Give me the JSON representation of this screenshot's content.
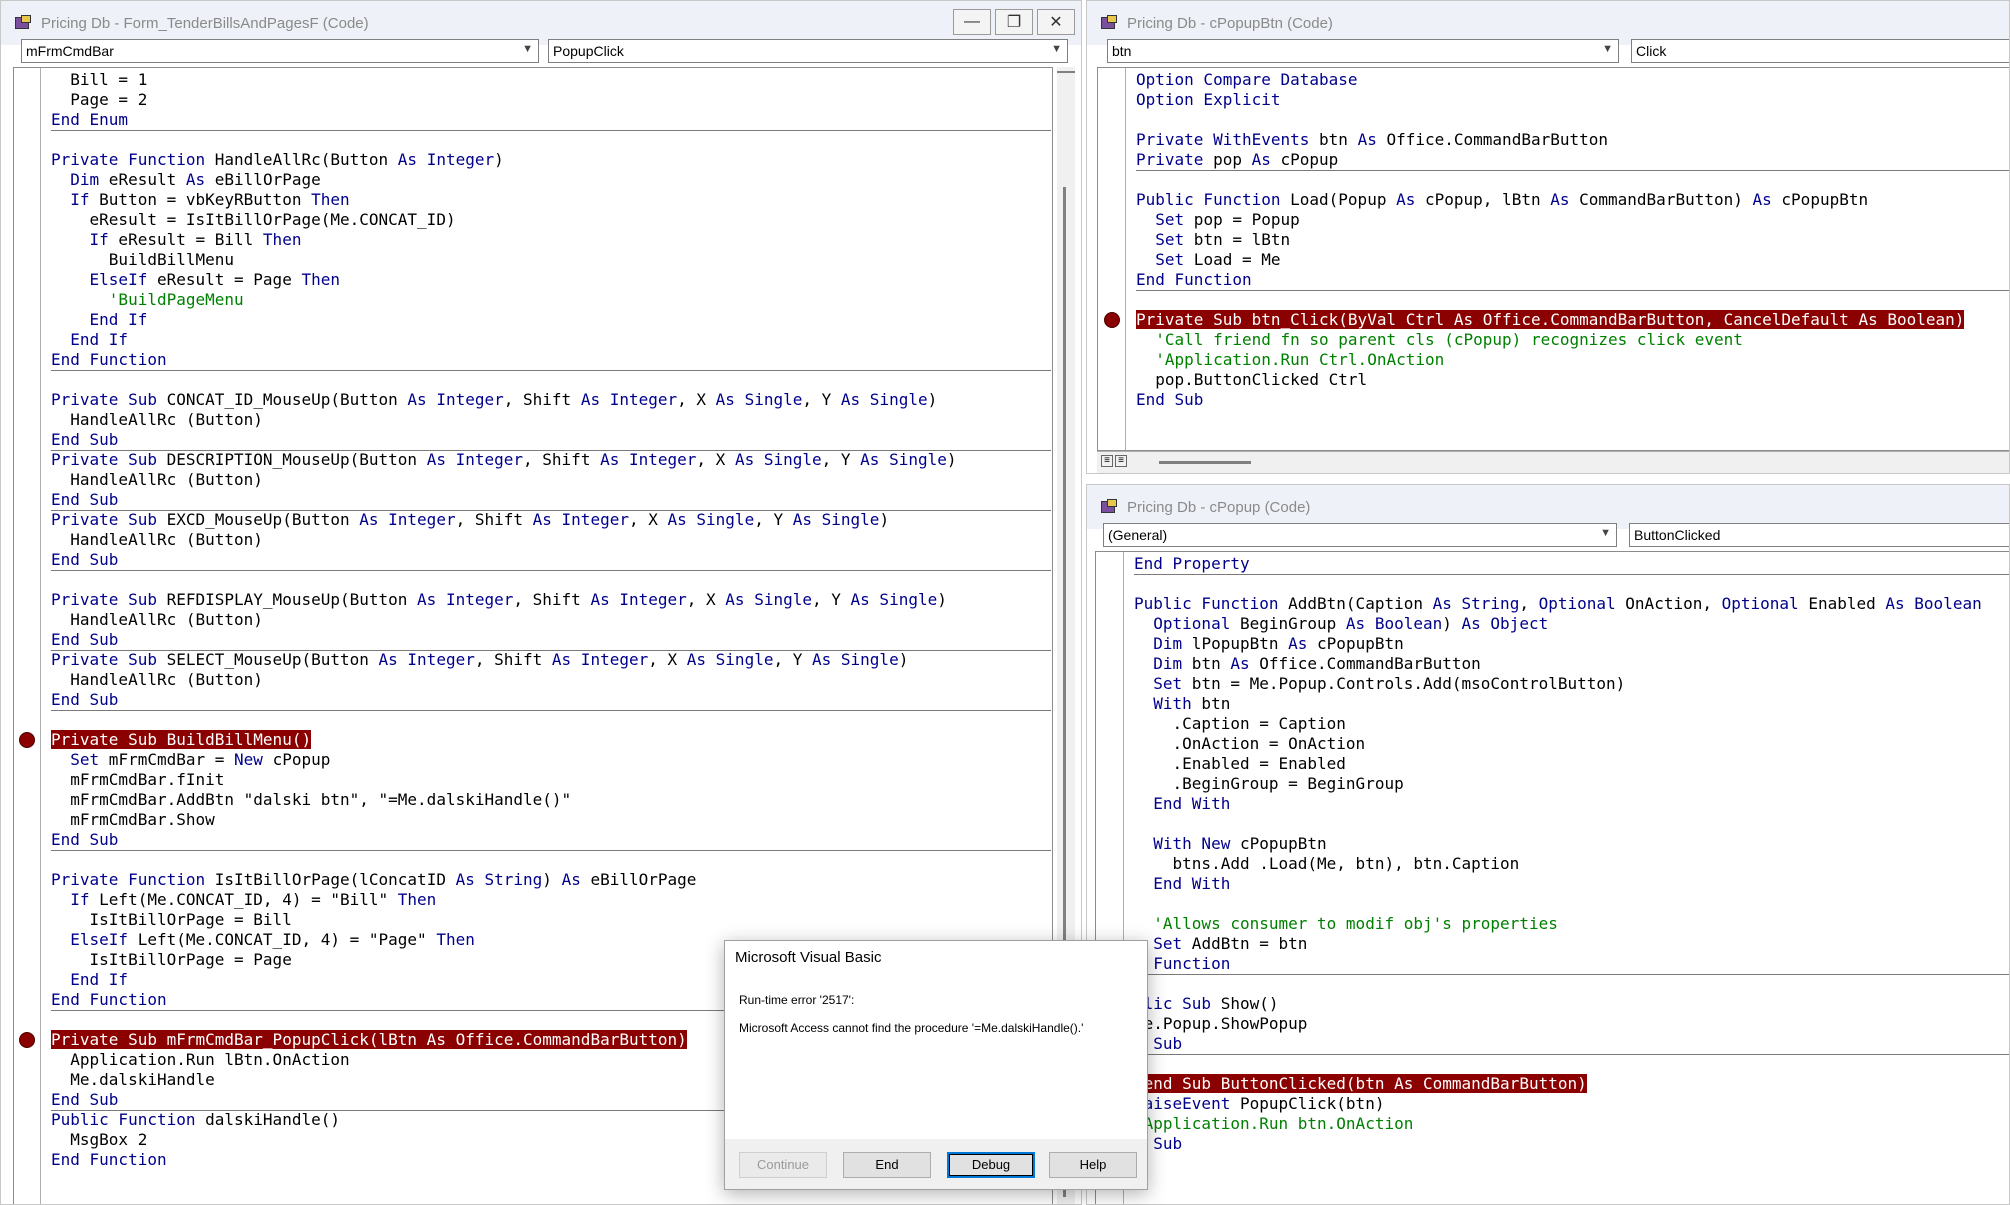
{
  "left_window": {
    "title": "Pricing Db - Form_TenderBillsAndPagesF (Code)",
    "object_combo": "mFrmCmdBar",
    "procedure_combo": "PopupClick",
    "buttons": {
      "minimize": "—",
      "maximize": "❐",
      "close": "✕"
    },
    "code_lines": [
      [
        {
          "t": "  Bill = 1"
        }
      ],
      [
        {
          "t": "  Page = 2"
        }
      ],
      [
        {
          "t": "End Enum",
          "c": "kw"
        }
      ],
      [
        {
          "t": ""
        }
      ],
      [
        {
          "t": "Private Function ",
          "c": "kw"
        },
        {
          "t": "HandleAllRc(Button "
        },
        {
          "t": "As Integer",
          "c": "kw"
        },
        {
          "t": ")"
        }
      ],
      [
        {
          "t": "  "
        },
        {
          "t": "Dim",
          "c": "kw"
        },
        {
          "t": " eResult "
        },
        {
          "t": "As",
          "c": "kw"
        },
        {
          "t": " eBillOrPage"
        }
      ],
      [
        {
          "t": "  "
        },
        {
          "t": "If",
          "c": "kw"
        },
        {
          "t": " Button = vbKeyRButton "
        },
        {
          "t": "Then",
          "c": "kw"
        }
      ],
      [
        {
          "t": "    eResult = IsItBillOrPage(Me.CONCAT_ID)"
        }
      ],
      [
        {
          "t": "    "
        },
        {
          "t": "If",
          "c": "kw"
        },
        {
          "t": " eResult = Bill "
        },
        {
          "t": "Then",
          "c": "kw"
        }
      ],
      [
        {
          "t": "      BuildBillMenu"
        }
      ],
      [
        {
          "t": "    "
        },
        {
          "t": "ElseIf",
          "c": "kw"
        },
        {
          "t": " eResult = Page "
        },
        {
          "t": "Then",
          "c": "kw"
        }
      ],
      [
        {
          "t": "      "
        },
        {
          "t": "'BuildPageMenu",
          "c": "cm"
        }
      ],
      [
        {
          "t": "    "
        },
        {
          "t": "End If",
          "c": "kw"
        }
      ],
      [
        {
          "t": "  "
        },
        {
          "t": "End If",
          "c": "kw"
        }
      ],
      [
        {
          "t": "End Function",
          "c": "kw"
        }
      ],
      [
        {
          "t": ""
        }
      ],
      [
        {
          "t": "Private Sub ",
          "c": "kw"
        },
        {
          "t": "CONCAT_ID_MouseUp(Button "
        },
        {
          "t": "As Integer",
          "c": "kw"
        },
        {
          "t": ", Shift "
        },
        {
          "t": "As Integer",
          "c": "kw"
        },
        {
          "t": ", X "
        },
        {
          "t": "As Single",
          "c": "kw"
        },
        {
          "t": ", Y "
        },
        {
          "t": "As Single",
          "c": "kw"
        },
        {
          "t": ")"
        }
      ],
      [
        {
          "t": "  HandleAllRc (Button)"
        }
      ],
      [
        {
          "t": "End Sub",
          "c": "kw"
        }
      ],
      [
        {
          "t": "Private Sub ",
          "c": "kw"
        },
        {
          "t": "DESCRIPTION_MouseUp(Button "
        },
        {
          "t": "As Integer",
          "c": "kw"
        },
        {
          "t": ", Shift "
        },
        {
          "t": "As Integer",
          "c": "kw"
        },
        {
          "t": ", X "
        },
        {
          "t": "As Single",
          "c": "kw"
        },
        {
          "t": ", Y "
        },
        {
          "t": "As Single",
          "c": "kw"
        },
        {
          "t": ")"
        }
      ],
      [
        {
          "t": "  HandleAllRc (Button)"
        }
      ],
      [
        {
          "t": "End Sub",
          "c": "kw"
        }
      ],
      [
        {
          "t": "Private Sub ",
          "c": "kw"
        },
        {
          "t": "EXCD_MouseUp(Button "
        },
        {
          "t": "As Integer",
          "c": "kw"
        },
        {
          "t": ", Shift "
        },
        {
          "t": "As Integer",
          "c": "kw"
        },
        {
          "t": ", X "
        },
        {
          "t": "As Single",
          "c": "kw"
        },
        {
          "t": ", Y "
        },
        {
          "t": "As Single",
          "c": "kw"
        },
        {
          "t": ")"
        }
      ],
      [
        {
          "t": "  HandleAllRc (Button)"
        }
      ],
      [
        {
          "t": "End Sub",
          "c": "kw"
        }
      ],
      [
        {
          "t": ""
        }
      ],
      [
        {
          "t": "Private Sub ",
          "c": "kw"
        },
        {
          "t": "REFDISPLAY_MouseUp(Button "
        },
        {
          "t": "As Integer",
          "c": "kw"
        },
        {
          "t": ", Shift "
        },
        {
          "t": "As Integer",
          "c": "kw"
        },
        {
          "t": ", X "
        },
        {
          "t": "As Single",
          "c": "kw"
        },
        {
          "t": ", Y "
        },
        {
          "t": "As Single",
          "c": "kw"
        },
        {
          "t": ")"
        }
      ],
      [
        {
          "t": "  HandleAllRc (Button)"
        }
      ],
      [
        {
          "t": "End Sub",
          "c": "kw"
        }
      ],
      [
        {
          "t": "Private Sub ",
          "c": "kw"
        },
        {
          "t": "SELECT_MouseUp(Button "
        },
        {
          "t": "As Integer",
          "c": "kw"
        },
        {
          "t": ", Shift "
        },
        {
          "t": "As Integer",
          "c": "kw"
        },
        {
          "t": ", X "
        },
        {
          "t": "As Single",
          "c": "kw"
        },
        {
          "t": ", Y "
        },
        {
          "t": "As Single",
          "c": "kw"
        },
        {
          "t": ")"
        }
      ],
      [
        {
          "t": "  HandleAllRc (Button)"
        }
      ],
      [
        {
          "t": "End Sub",
          "c": "kw"
        }
      ],
      [
        {
          "t": ""
        }
      ],
      [
        {
          "t": "Private Sub BuildBillMenu()",
          "c": "hl"
        }
      ],
      [
        {
          "t": "  "
        },
        {
          "t": "Set",
          "c": "kw"
        },
        {
          "t": " mFrmCmdBar = "
        },
        {
          "t": "New",
          "c": "kw"
        },
        {
          "t": " cPopup"
        }
      ],
      [
        {
          "t": "  mFrmCmdBar.fInit"
        }
      ],
      [
        {
          "t": "  mFrmCmdBar.AddBtn \"dalski btn\", \"=Me.dalskiHandle()\""
        }
      ],
      [
        {
          "t": "  mFrmCmdBar.Show"
        }
      ],
      [
        {
          "t": "End Sub",
          "c": "kw"
        }
      ],
      [
        {
          "t": ""
        }
      ],
      [
        {
          "t": "Private Function ",
          "c": "kw"
        },
        {
          "t": "IsItBillOrPage(lConcatID "
        },
        {
          "t": "As String",
          "c": "kw"
        },
        {
          "t": ") "
        },
        {
          "t": "As",
          "c": "kw"
        },
        {
          "t": " eBillOrPage"
        }
      ],
      [
        {
          "t": "  "
        },
        {
          "t": "If",
          "c": "kw"
        },
        {
          "t": " Left(Me.CONCAT_ID, 4) = \"Bill\" "
        },
        {
          "t": "Then",
          "c": "kw"
        }
      ],
      [
        {
          "t": "    IsItBillOrPage = Bill"
        }
      ],
      [
        {
          "t": "  "
        },
        {
          "t": "ElseIf",
          "c": "kw"
        },
        {
          "t": " Left(Me.CONCAT_ID, 4) = \"Page\" "
        },
        {
          "t": "Then",
          "c": "kw"
        }
      ],
      [
        {
          "t": "    IsItBillOrPage = Page"
        }
      ],
      [
        {
          "t": "  "
        },
        {
          "t": "End If",
          "c": "kw"
        }
      ],
      [
        {
          "t": "End Function",
          "c": "kw"
        }
      ],
      [
        {
          "t": ""
        }
      ],
      [
        {
          "t": "Private Sub mFrmCmdBar_PopupClick(lBtn As Office.CommandBarButton)",
          "c": "hl"
        }
      ],
      [
        {
          "t": "  Application.Run lBtn.OnAction"
        }
      ],
      [
        {
          "t": "  Me.dalskiHandle"
        }
      ],
      [
        {
          "t": "End Sub",
          "c": "kw"
        }
      ],
      [
        {
          "t": "Public Function ",
          "c": "kw"
        },
        {
          "t": "dalskiHandle()"
        }
      ],
      [
        {
          "t": "  MsgBox 2"
        }
      ],
      [
        {
          "t": "End Function",
          "c": "kw"
        }
      ]
    ]
  },
  "top_right_window": {
    "title": "Pricing Db - cPopupBtn (Code)",
    "object_combo": "btn",
    "procedure_combo": "Click",
    "code_lines": [
      [
        {
          "t": "Option Compare Database",
          "c": "kw"
        }
      ],
      [
        {
          "t": "Option Explicit",
          "c": "kw"
        }
      ],
      [
        {
          "t": ""
        }
      ],
      [
        {
          "t": "Private WithEvents ",
          "c": "kw"
        },
        {
          "t": "btn "
        },
        {
          "t": "As",
          "c": "kw"
        },
        {
          "t": " Office.CommandBarButton"
        }
      ],
      [
        {
          "t": "Private ",
          "c": "kw"
        },
        {
          "t": "pop "
        },
        {
          "t": "As",
          "c": "kw"
        },
        {
          "t": " cPopup"
        }
      ],
      [
        {
          "t": ""
        }
      ],
      [
        {
          "t": "Public Function ",
          "c": "kw"
        },
        {
          "t": "Load(Popup "
        },
        {
          "t": "As",
          "c": "kw"
        },
        {
          "t": " cPopup, lBtn "
        },
        {
          "t": "As",
          "c": "kw"
        },
        {
          "t": " CommandBarButton) "
        },
        {
          "t": "As",
          "c": "kw"
        },
        {
          "t": " cPopupBtn"
        }
      ],
      [
        {
          "t": "  "
        },
        {
          "t": "Set",
          "c": "kw"
        },
        {
          "t": " pop = Popup"
        }
      ],
      [
        {
          "t": "  "
        },
        {
          "t": "Set",
          "c": "kw"
        },
        {
          "t": " btn = lBtn"
        }
      ],
      [
        {
          "t": "  "
        },
        {
          "t": "Set",
          "c": "kw"
        },
        {
          "t": " Load = Me"
        }
      ],
      [
        {
          "t": "End Function",
          "c": "kw"
        }
      ],
      [
        {
          "t": ""
        }
      ],
      [
        {
          "t": "Private Sub btn_Click(ByVal Ctrl As Office.CommandBarButton, CancelDefault As Boolean)",
          "c": "hl"
        }
      ],
      [
        {
          "t": "  "
        },
        {
          "t": "'Call friend fn so parent cls (cPopup) recognizes click event",
          "c": "cm"
        }
      ],
      [
        {
          "t": "  "
        },
        {
          "t": "'Application.Run Ctrl.OnAction",
          "c": "cm"
        }
      ],
      [
        {
          "t": "  pop.ButtonClicked Ctrl"
        }
      ],
      [
        {
          "t": "End Sub",
          "c": "kw"
        }
      ]
    ]
  },
  "bottom_right_window": {
    "title": "Pricing Db - cPopup (Code)",
    "object_combo": "(General)",
    "procedure_combo": "ButtonClicked",
    "code_lines": [
      [
        {
          "t": "End Property",
          "c": "kw"
        }
      ],
      [
        {
          "t": ""
        }
      ],
      [
        {
          "t": "Public Function ",
          "c": "kw"
        },
        {
          "t": "AddBtn(Caption "
        },
        {
          "t": "As String",
          "c": "kw"
        },
        {
          "t": ", "
        },
        {
          "t": "Optional",
          "c": "kw"
        },
        {
          "t": " OnAction, "
        },
        {
          "t": "Optional",
          "c": "kw"
        },
        {
          "t": " Enabled "
        },
        {
          "t": "As Boolean",
          "c": "kw"
        }
      ],
      [
        {
          "t": "  "
        },
        {
          "t": "Optional",
          "c": "kw"
        },
        {
          "t": " BeginGroup "
        },
        {
          "t": "As Boolean",
          "c": "kw"
        },
        {
          "t": ") "
        },
        {
          "t": "As Object",
          "c": "kw"
        }
      ],
      [
        {
          "t": "  "
        },
        {
          "t": "Dim",
          "c": "kw"
        },
        {
          "t": " lPopupBtn "
        },
        {
          "t": "As",
          "c": "kw"
        },
        {
          "t": " cPopupBtn"
        }
      ],
      [
        {
          "t": "  "
        },
        {
          "t": "Dim",
          "c": "kw"
        },
        {
          "t": " btn "
        },
        {
          "t": "As",
          "c": "kw"
        },
        {
          "t": " Office.CommandBarButton"
        }
      ],
      [
        {
          "t": "  "
        },
        {
          "t": "Set",
          "c": "kw"
        },
        {
          "t": " btn = Me.Popup.Controls.Add(msoControlButton)"
        }
      ],
      [
        {
          "t": "  "
        },
        {
          "t": "With",
          "c": "kw"
        },
        {
          "t": " btn"
        }
      ],
      [
        {
          "t": "    .Caption = Caption"
        }
      ],
      [
        {
          "t": "    .OnAction = OnAction"
        }
      ],
      [
        {
          "t": "    .Enabled = Enabled"
        }
      ],
      [
        {
          "t": "    .BeginGroup = BeginGroup"
        }
      ],
      [
        {
          "t": "  "
        },
        {
          "t": "End With",
          "c": "kw"
        }
      ],
      [
        {
          "t": ""
        }
      ],
      [
        {
          "t": "  "
        },
        {
          "t": "With New",
          "c": "kw"
        },
        {
          "t": " cPopupBtn"
        }
      ],
      [
        {
          "t": "    btns.Add .Load(Me, btn), btn.Caption"
        }
      ],
      [
        {
          "t": "  "
        },
        {
          "t": "End With",
          "c": "kw"
        }
      ],
      [
        {
          "t": ""
        }
      ],
      [
        {
          "t": "  "
        },
        {
          "t": "'Allows consumer to modif obj's properties",
          "c": "cm"
        }
      ],
      [
        {
          "t": "  "
        },
        {
          "t": "Set",
          "c": "kw"
        },
        {
          "t": " AddBtn = btn"
        }
      ],
      [
        {
          "t": "d Function",
          "c": "kw"
        }
      ],
      [
        {
          "t": ""
        }
      ],
      [
        {
          "t": "blic Sub ",
          "c": "kw"
        },
        {
          "t": "Show()"
        }
      ],
      [
        {
          "t": "Me.Popup.ShowPopup"
        }
      ],
      [
        {
          "t": "d Sub",
          "c": "kw"
        }
      ],
      [
        {
          "t": ""
        }
      ],
      [
        {
          "t": "iend Sub ButtonClicked(btn As CommandBarButton)",
          "c": "hl"
        }
      ],
      [
        {
          "t": "RaiseEvent",
          "c": "kw"
        },
        {
          "t": " PopupClick(btn)"
        }
      ],
      [
        {
          "t": "'Application.Run btn.OnAction",
          "c": "cm"
        }
      ],
      [
        {
          "t": "d Sub",
          "c": "kw"
        }
      ]
    ]
  },
  "dialog": {
    "title": "Microsoft Visual Basic",
    "error_line": "Run-time error '2517':",
    "message": "Microsoft Access cannot find the procedure '=Me.dalskiHandle().'",
    "buttons": {
      "continue": "Continue",
      "end": "End",
      "debug": "Debug",
      "help": "Help"
    }
  },
  "colors": {
    "keyword": "#00008b",
    "comment": "#008000",
    "breakpoint": "#8b0000"
  }
}
